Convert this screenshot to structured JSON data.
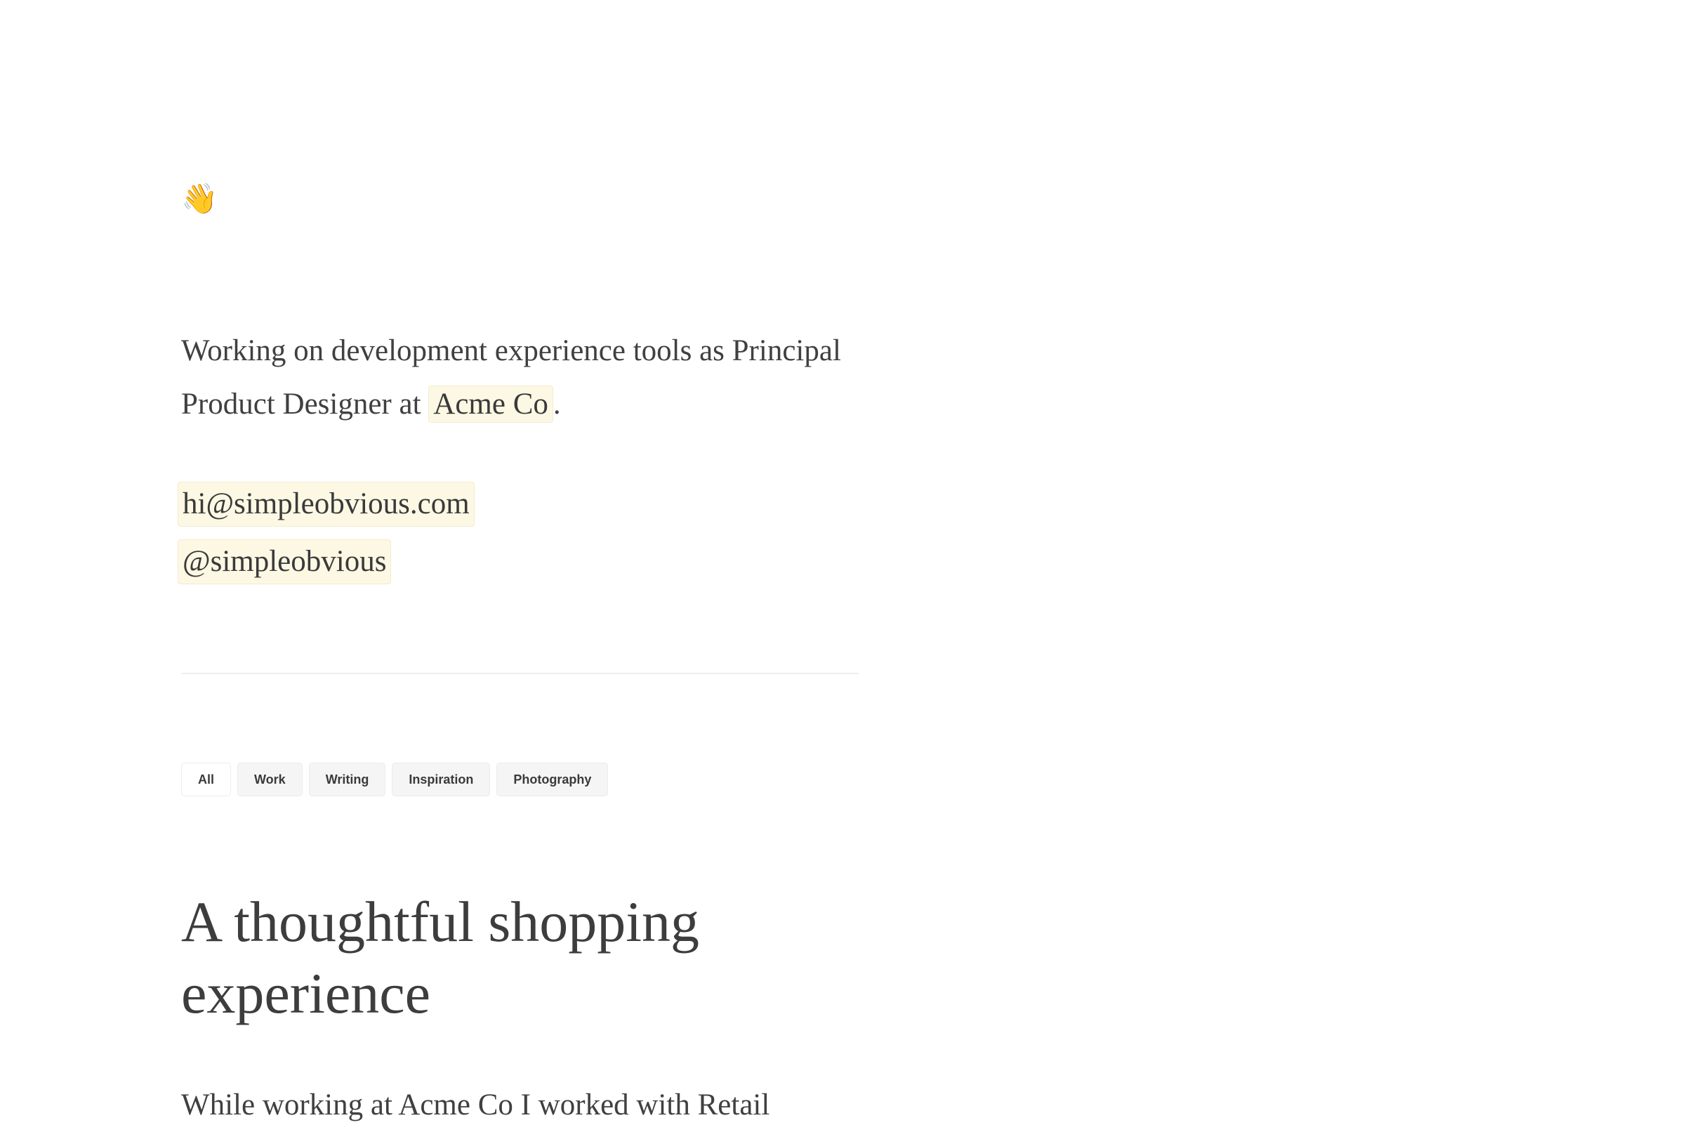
{
  "intro": {
    "wave_emoji": "👋",
    "text_before": "Working on development experience tools as Principal Product Designer at ",
    "company_link": "Acme Co",
    "text_after": "."
  },
  "contacts": {
    "email": "hi@simpleobvious.com",
    "handle": "@simpleobvious"
  },
  "filters": {
    "items": [
      "All",
      "Work",
      "Writing",
      "Inspiration",
      "Photography"
    ],
    "active": "All"
  },
  "post": {
    "title": "A thoughtful shopping experience",
    "excerpt": "While working at Acme Co I worked with Retail"
  },
  "colors": {
    "highlight_bg": "#fdf8e4",
    "text": "#3a3a3a"
  }
}
